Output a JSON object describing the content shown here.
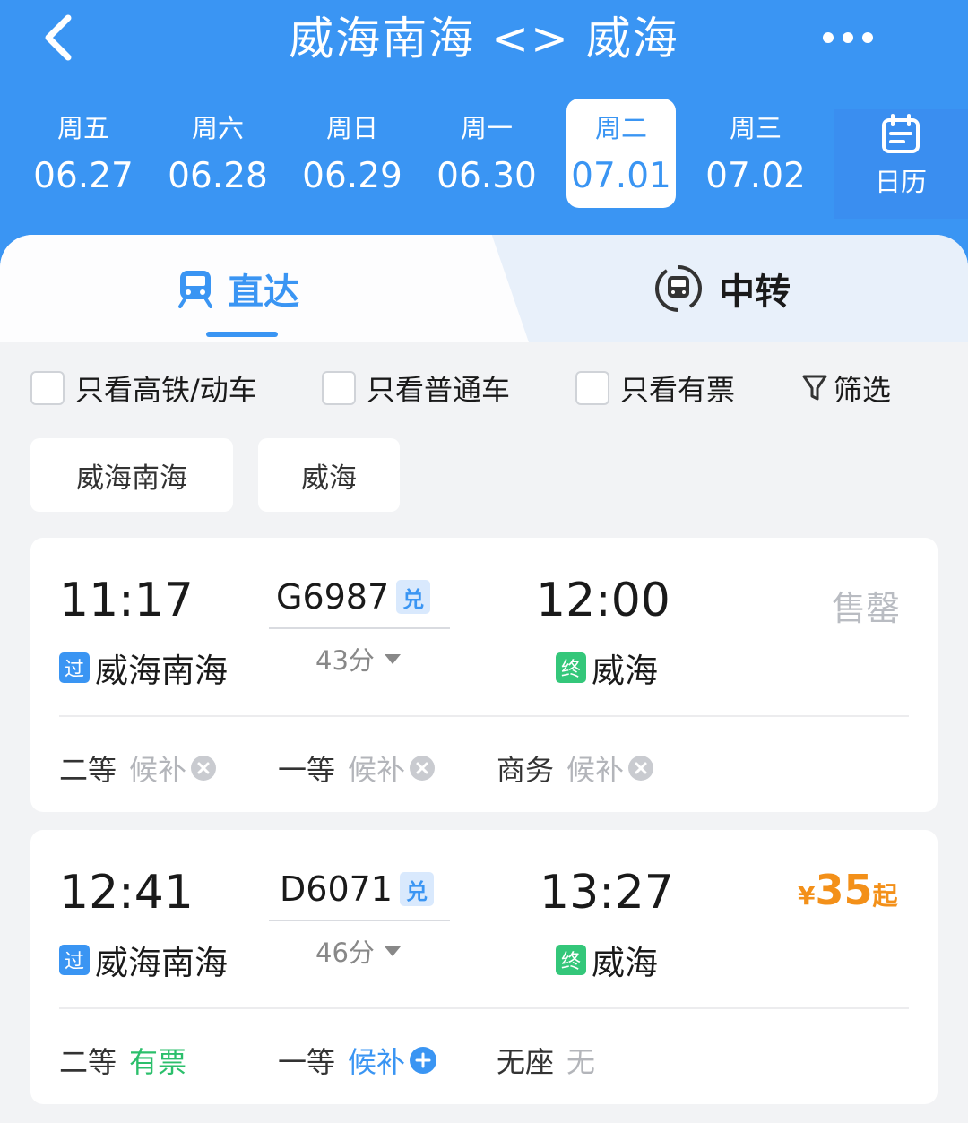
{
  "header": {
    "title": "威海南海 <> 威海",
    "dates": [
      {
        "weekday": "周五",
        "date": "06.27",
        "active": false
      },
      {
        "weekday": "周六",
        "date": "06.28",
        "active": false
      },
      {
        "weekday": "周日",
        "date": "06.29",
        "active": false
      },
      {
        "weekday": "周一",
        "date": "06.30",
        "active": false
      },
      {
        "weekday": "周二",
        "date": "07.01",
        "active": true
      },
      {
        "weekday": "周三",
        "date": "07.02",
        "active": false
      }
    ],
    "calendar_label": "日历"
  },
  "tabs": {
    "direct": "直达",
    "transfer": "中转"
  },
  "filters": {
    "high_speed": "只看高铁/动车",
    "regular": "只看普通车",
    "available": "只看有票",
    "filter_label": "筛选"
  },
  "stations": [
    "威海南海",
    "威海"
  ],
  "trains": [
    {
      "depart_time": "11:17",
      "train_no": "G6987",
      "redeem_tag": "兑",
      "duration": "43分",
      "arrive_time": "12:00",
      "from_tag": "过",
      "from_station": "威海南海",
      "to_tag": "终",
      "to_station": "威海",
      "status": "售罄",
      "seats": [
        {
          "class": "二等",
          "status": "候补"
        },
        {
          "class": "一等",
          "status": "候补"
        },
        {
          "class": "商务",
          "status": "候补"
        }
      ]
    },
    {
      "depart_time": "12:41",
      "train_no": "D6071",
      "redeem_tag": "兑",
      "duration": "46分",
      "arrive_time": "13:27",
      "from_tag": "过",
      "from_station": "威海南海",
      "to_tag": "终",
      "to_station": "威海",
      "price_currency": "¥",
      "price_value": "35",
      "price_suffix": "起",
      "seats": [
        {
          "class": "二等",
          "status": "有票"
        },
        {
          "class": "一等",
          "status": "候补"
        },
        {
          "class": "无座",
          "status": "无"
        }
      ]
    }
  ],
  "colors": {
    "brand_blue": "#3a95f3",
    "price_orange": "#f39019",
    "available_green": "#2bbf6b"
  }
}
